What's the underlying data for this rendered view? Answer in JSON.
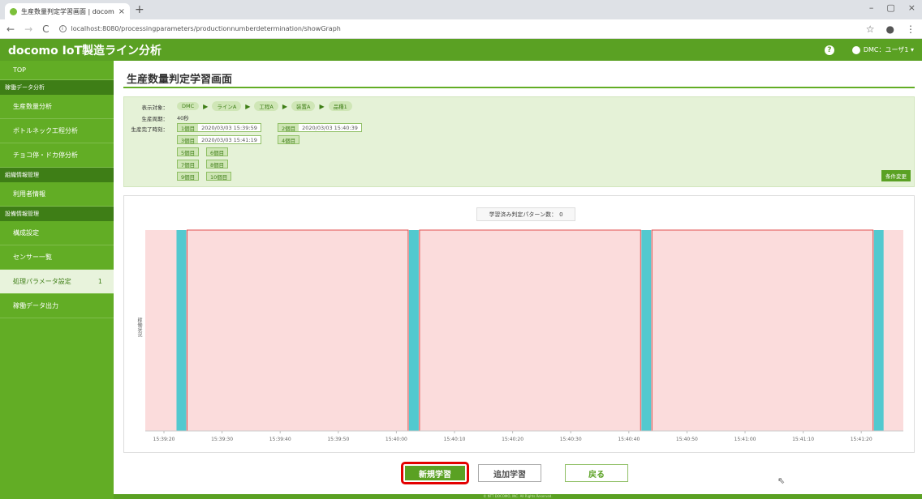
{
  "browser": {
    "tab_title": "生産数量判定学習画面 | docom",
    "tab_close": "×",
    "new_tab": "+",
    "win_min": "–",
    "win_max": "▢",
    "win_close": "×",
    "url": "localhost:8080/processingparameters/productionnumberdetermination/showGraph"
  },
  "app": {
    "title": "docomo IoT製造ライン分析",
    "help": "?",
    "user": "DMC：ユーザ1 ▾"
  },
  "sidebar": {
    "top": "TOP",
    "groups": [
      {
        "head": "稼働データ分析",
        "items": [
          "生産数量分析",
          "ボトルネック工程分析",
          "チョコ停・ドカ停分析"
        ]
      },
      {
        "head": "組織情報管理",
        "items": [
          "利用者情報"
        ]
      },
      {
        "head": "設備情報管理",
        "items": [
          "構成設定",
          "センサー一覧",
          "処理パラメータ設定",
          "稼働データ出力"
        ]
      }
    ],
    "active_badge": "1"
  },
  "page": {
    "title": "生産数量判定学習画面",
    "labels": {
      "target": "表示対象：",
      "cycle": "生産周期：",
      "done_time": "生産完了時刻："
    },
    "crumbs": [
      "DMC",
      "ラインA",
      "工程A",
      "装置A",
      "品種1"
    ],
    "cycle_value": "40秒",
    "entries": [
      {
        "num": "1個目",
        "ts": "2020/03/03 15:39:59"
      },
      {
        "num": "2個目",
        "ts": "2020/03/03 15:40:39"
      },
      {
        "num": "3個目",
        "ts": "2020/03/03 15:41:19"
      },
      {
        "num": "4個目",
        "ts": ""
      },
      {
        "num": "5個目",
        "ts": ""
      },
      {
        "num": "6個目",
        "ts": ""
      },
      {
        "num": "7個目",
        "ts": ""
      },
      {
        "num": "8個目",
        "ts": ""
      },
      {
        "num": "9個目",
        "ts": ""
      },
      {
        "num": "10個目",
        "ts": ""
      }
    ],
    "change_button": "条件変更",
    "pattern_label": "学習済み判定パターン数：",
    "pattern_count": "0",
    "y_label": "稼働状況",
    "buttons": {
      "new": "新規学習",
      "add": "追加学習",
      "back": "戻る"
    },
    "footer": "© NTT DOCOMO, INC. All Rights Reserved."
  },
  "chart_data": {
    "type": "area",
    "x_ticks": [
      "15:39:20",
      "15:39:30",
      "15:39:40",
      "15:39:50",
      "15:40:00",
      "15:40:10",
      "15:40:20",
      "15:40:30",
      "15:40:40",
      "15:40:50",
      "15:41:00",
      "15:41:10",
      "15:41:20"
    ],
    "cyan_bands": [
      "15:39:23",
      "15:40:03",
      "15:40:43",
      "15:41:23"
    ],
    "colors": {
      "pink": "#fbdcdc",
      "border": "#e05050",
      "cyan": "#52c9cf"
    }
  }
}
